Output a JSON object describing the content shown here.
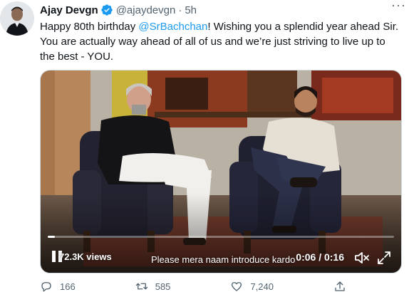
{
  "author": {
    "name": "Ajay Devgn",
    "handle": "@ajaydevgn",
    "separator": "·",
    "time": "5h",
    "verified": true
  },
  "tweet": {
    "line1_prefix": "Happy 80th birthday ",
    "mention": "@SrBachchan",
    "line1_suffix": "! Wishing you a splendid year ahead Sir.",
    "line2": "You are actually way ahead of all of us and we’re just striving to live up to",
    "line3": "the best - YOU."
  },
  "video": {
    "views": "72.3K views",
    "caption": "Please mera naam introduce kardo",
    "timecode": "0:06 / 0:16",
    "progress_fraction": 0.02
  },
  "actions": {
    "reply_count": "166",
    "retweet_count": "585",
    "like_count": "7,240",
    "share_icon": "share-icon"
  },
  "colors": {
    "accent": "#1d9bf0",
    "muted": "#536471",
    "text": "#0f1419"
  }
}
